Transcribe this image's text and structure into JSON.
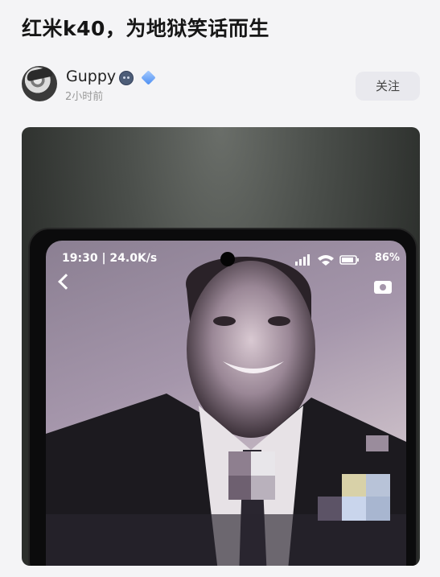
{
  "post": {
    "title": "红米k40，为地狱笑话而生",
    "author": {
      "name": "Guppy",
      "time": "2小时前",
      "emoji_icon": "cold-face-emoji-icon",
      "badge_icon": "blue-diamond-verified-icon"
    },
    "follow_label": "关注"
  },
  "phone_screen": {
    "status_time": "19:30 | 24.0K/s",
    "battery": "86%",
    "icons": [
      "alarm-icon",
      "notification-icon",
      "signal-icon",
      "wifi-icon",
      "battery-icon",
      "back-icon",
      "camera-icon"
    ]
  },
  "colors": {
    "background": "#f4f4f6",
    "title_text": "#161616",
    "follow_button_bg": "#e9e9ee",
    "badge": "#4b8df2"
  }
}
